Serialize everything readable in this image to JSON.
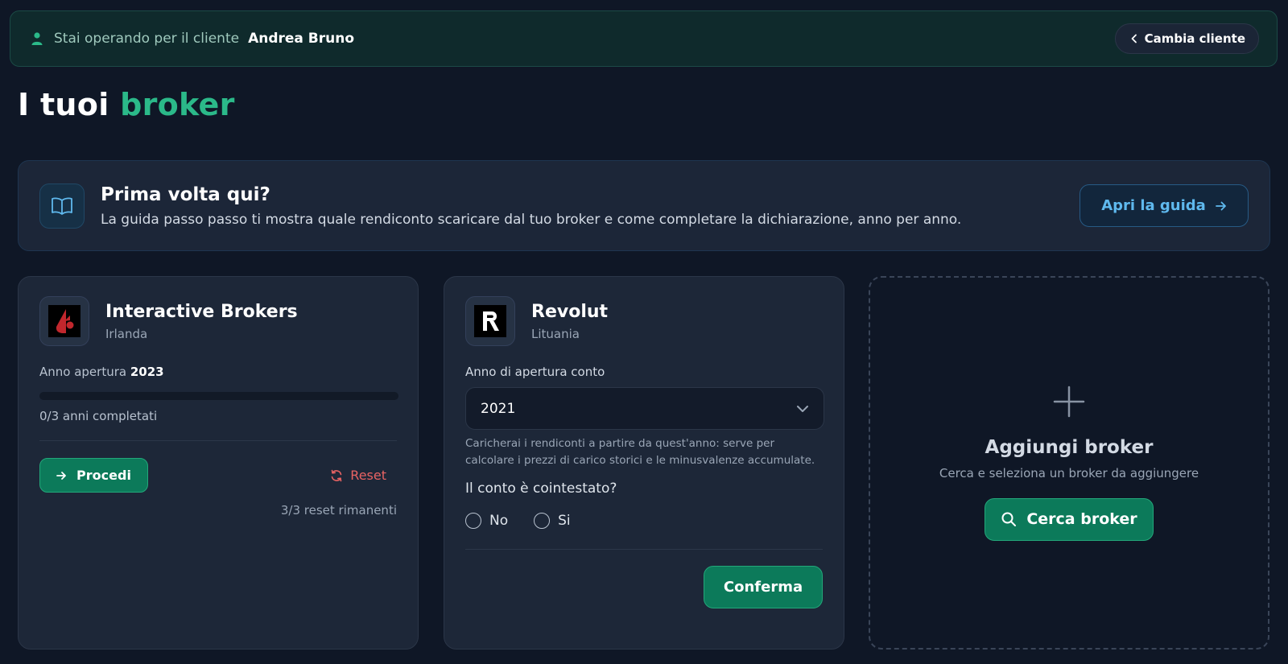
{
  "client_bar": {
    "prefix": "Stai operando per il cliente",
    "client_name": "Andrea Bruno",
    "change_button": "Cambia cliente",
    "icon": "user-icon"
  },
  "page_title": {
    "main": "I tuoi",
    "accent": "broker"
  },
  "guide": {
    "icon": "book-icon",
    "title": "Prima volta qui?",
    "description": "La guida passo passo ti mostra quale rendiconto scaricare dal tuo broker e come completare la dichiarazione, anno per anno.",
    "button": "Apri la guida"
  },
  "brokers": [
    {
      "name": "Interactive Brokers",
      "country": "Irlanda",
      "open_year_label": "Anno apertura",
      "open_year": "2023",
      "progress_fraction": 0,
      "progress_text": "0/3 anni completati",
      "proceed_button": "Procedi",
      "reset_button": "Reset",
      "resets_left": "3/3 reset rimanenti"
    },
    {
      "name": "Revolut",
      "country": "Lituania",
      "open_year_label": "Anno di apertura conto",
      "selected_year": "2021",
      "help_text": "Caricherai i rendiconti a partire da quest'anno: serve per calcolare i prezzi di carico storici e le minusvalenze accumulate.",
      "joint_question": "Il conto è cointestato?",
      "radio_no": "No",
      "radio_yes": "Si",
      "confirm_button": "Conferma"
    }
  ],
  "add_card": {
    "title": "Aggiungi broker",
    "description": "Cerca e seleziona un broker da aggiungere",
    "search_button": "Cerca broker"
  },
  "colors": {
    "accent_green": "#2bb989",
    "button_green": "#0c7a5a",
    "link_blue": "#5fb9ee",
    "danger_red": "#e86363",
    "background": "#0f1726"
  }
}
